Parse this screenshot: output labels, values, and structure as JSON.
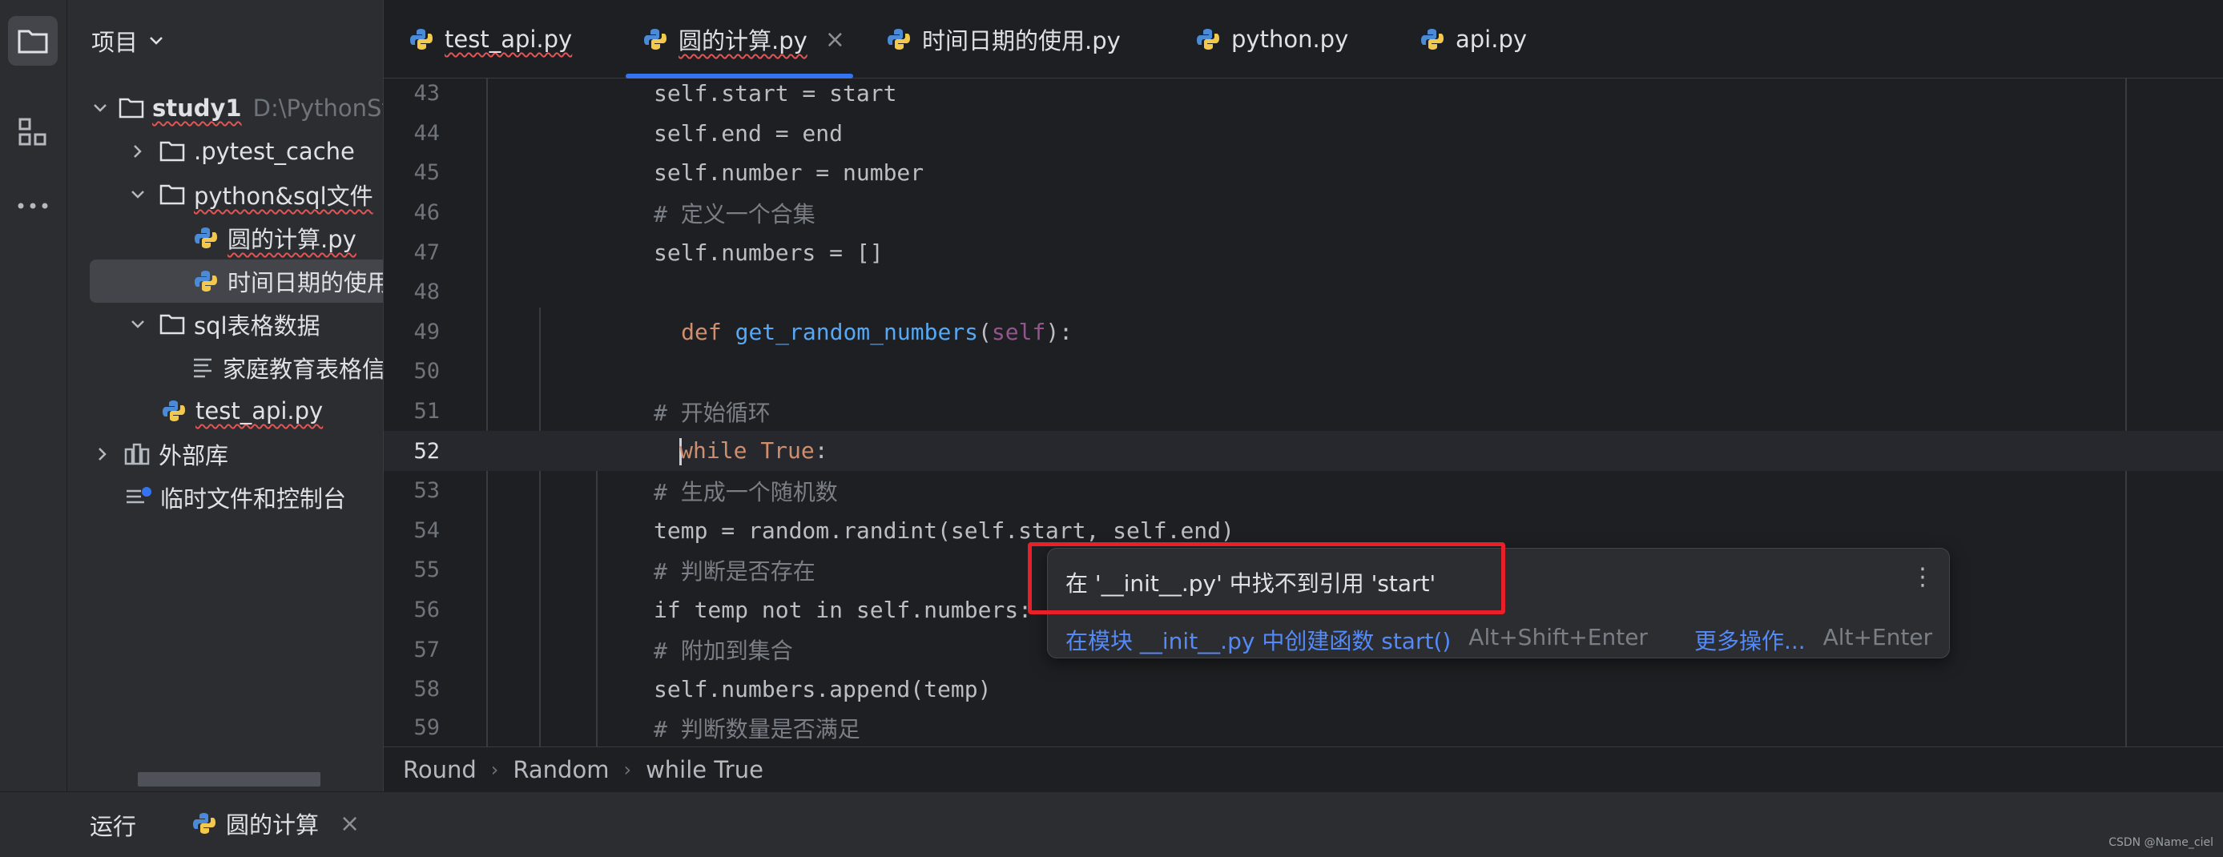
{
  "project": {
    "header": "项目",
    "tree": [
      {
        "label": "study1",
        "suffix": "D:\\PythonSt",
        "kind": "folder",
        "expanded": true,
        "squiggle": true
      },
      {
        "label": ".pytest_cache",
        "kind": "folder",
        "expanded": false
      },
      {
        "label": "python&sql文件",
        "kind": "folder",
        "expanded": true,
        "squiggle": true
      },
      {
        "label": "圆的计算.py",
        "kind": "python",
        "squiggle": true
      },
      {
        "label": "时间日期的使用",
        "kind": "python",
        "selected": true
      },
      {
        "label": "sql表格数据",
        "kind": "folder",
        "expanded": true
      },
      {
        "label": "家庭教育表格信",
        "kind": "text"
      },
      {
        "label": "test_api.py",
        "kind": "python",
        "squiggle": true
      },
      {
        "label": "外部库",
        "kind": "library",
        "expanded": false
      },
      {
        "label": "临时文件和控制台",
        "kind": "scratch"
      }
    ]
  },
  "tabs": [
    {
      "label": "test_api.py",
      "active": false
    },
    {
      "label": "圆的计算.py",
      "active": true
    },
    {
      "label": "时间日期的使用.py",
      "active": false
    },
    {
      "label": "python.py",
      "active": false
    },
    {
      "label": "api.py",
      "active": false
    }
  ],
  "tab_close_glyph": "×",
  "code": {
    "current_line": 52,
    "lines": [
      {
        "n": "43"
      },
      {
        "n": "44"
      },
      {
        "n": "45"
      },
      {
        "n": "46"
      },
      {
        "n": "47"
      },
      {
        "n": "48"
      },
      {
        "n": "49"
      },
      {
        "n": "50"
      },
      {
        "n": "51"
      },
      {
        "n": "52"
      },
      {
        "n": "53"
      },
      {
        "n": "54"
      },
      {
        "n": "55"
      },
      {
        "n": "56"
      },
      {
        "n": "57"
      },
      {
        "n": "58"
      },
      {
        "n": "59"
      }
    ],
    "text": {
      "l43": "self.start = start",
      "l44": "self.end = end",
      "l45": "self.number = number",
      "l46": "# 定义一个合集",
      "l47": "self.numbers = []",
      "l49_def": "def",
      "l49_fn": "get_random_numbers",
      "l49_self": "self",
      "l51": "# 开始循环",
      "l52_kw": "while",
      "l52_true": "True",
      "l53": "# 生成一个随机数",
      "l54": "temp = random.randint(self.start, self.end)",
      "l55": "# 判断是否存在",
      "l56": "if temp not in self.numbers:",
      "l57": "# 附加到集合",
      "l58": "self.numbers.append(temp)",
      "l59": "# 判断数量是否满足"
    }
  },
  "breadcrumb": [
    "Round",
    "Random",
    "while True"
  ],
  "popup": {
    "title": "在 '__init__.py' 中找不到引用 'start'",
    "more_glyph": "⋮",
    "action1": "在模块 __init__.py 中创建函数 start()",
    "action1_key": "Alt+Shift+Enter",
    "action2": "更多操作...",
    "action2_key": "Alt+Enter"
  },
  "bottom": {
    "run_label": "运行",
    "run_tab": "圆的计算",
    "close_glyph": "×"
  },
  "watermark": "CSDN @Name_ciel",
  "colors": {
    "accent": "#3574f0",
    "error_box": "#e8202a",
    "link": "#548af7"
  }
}
